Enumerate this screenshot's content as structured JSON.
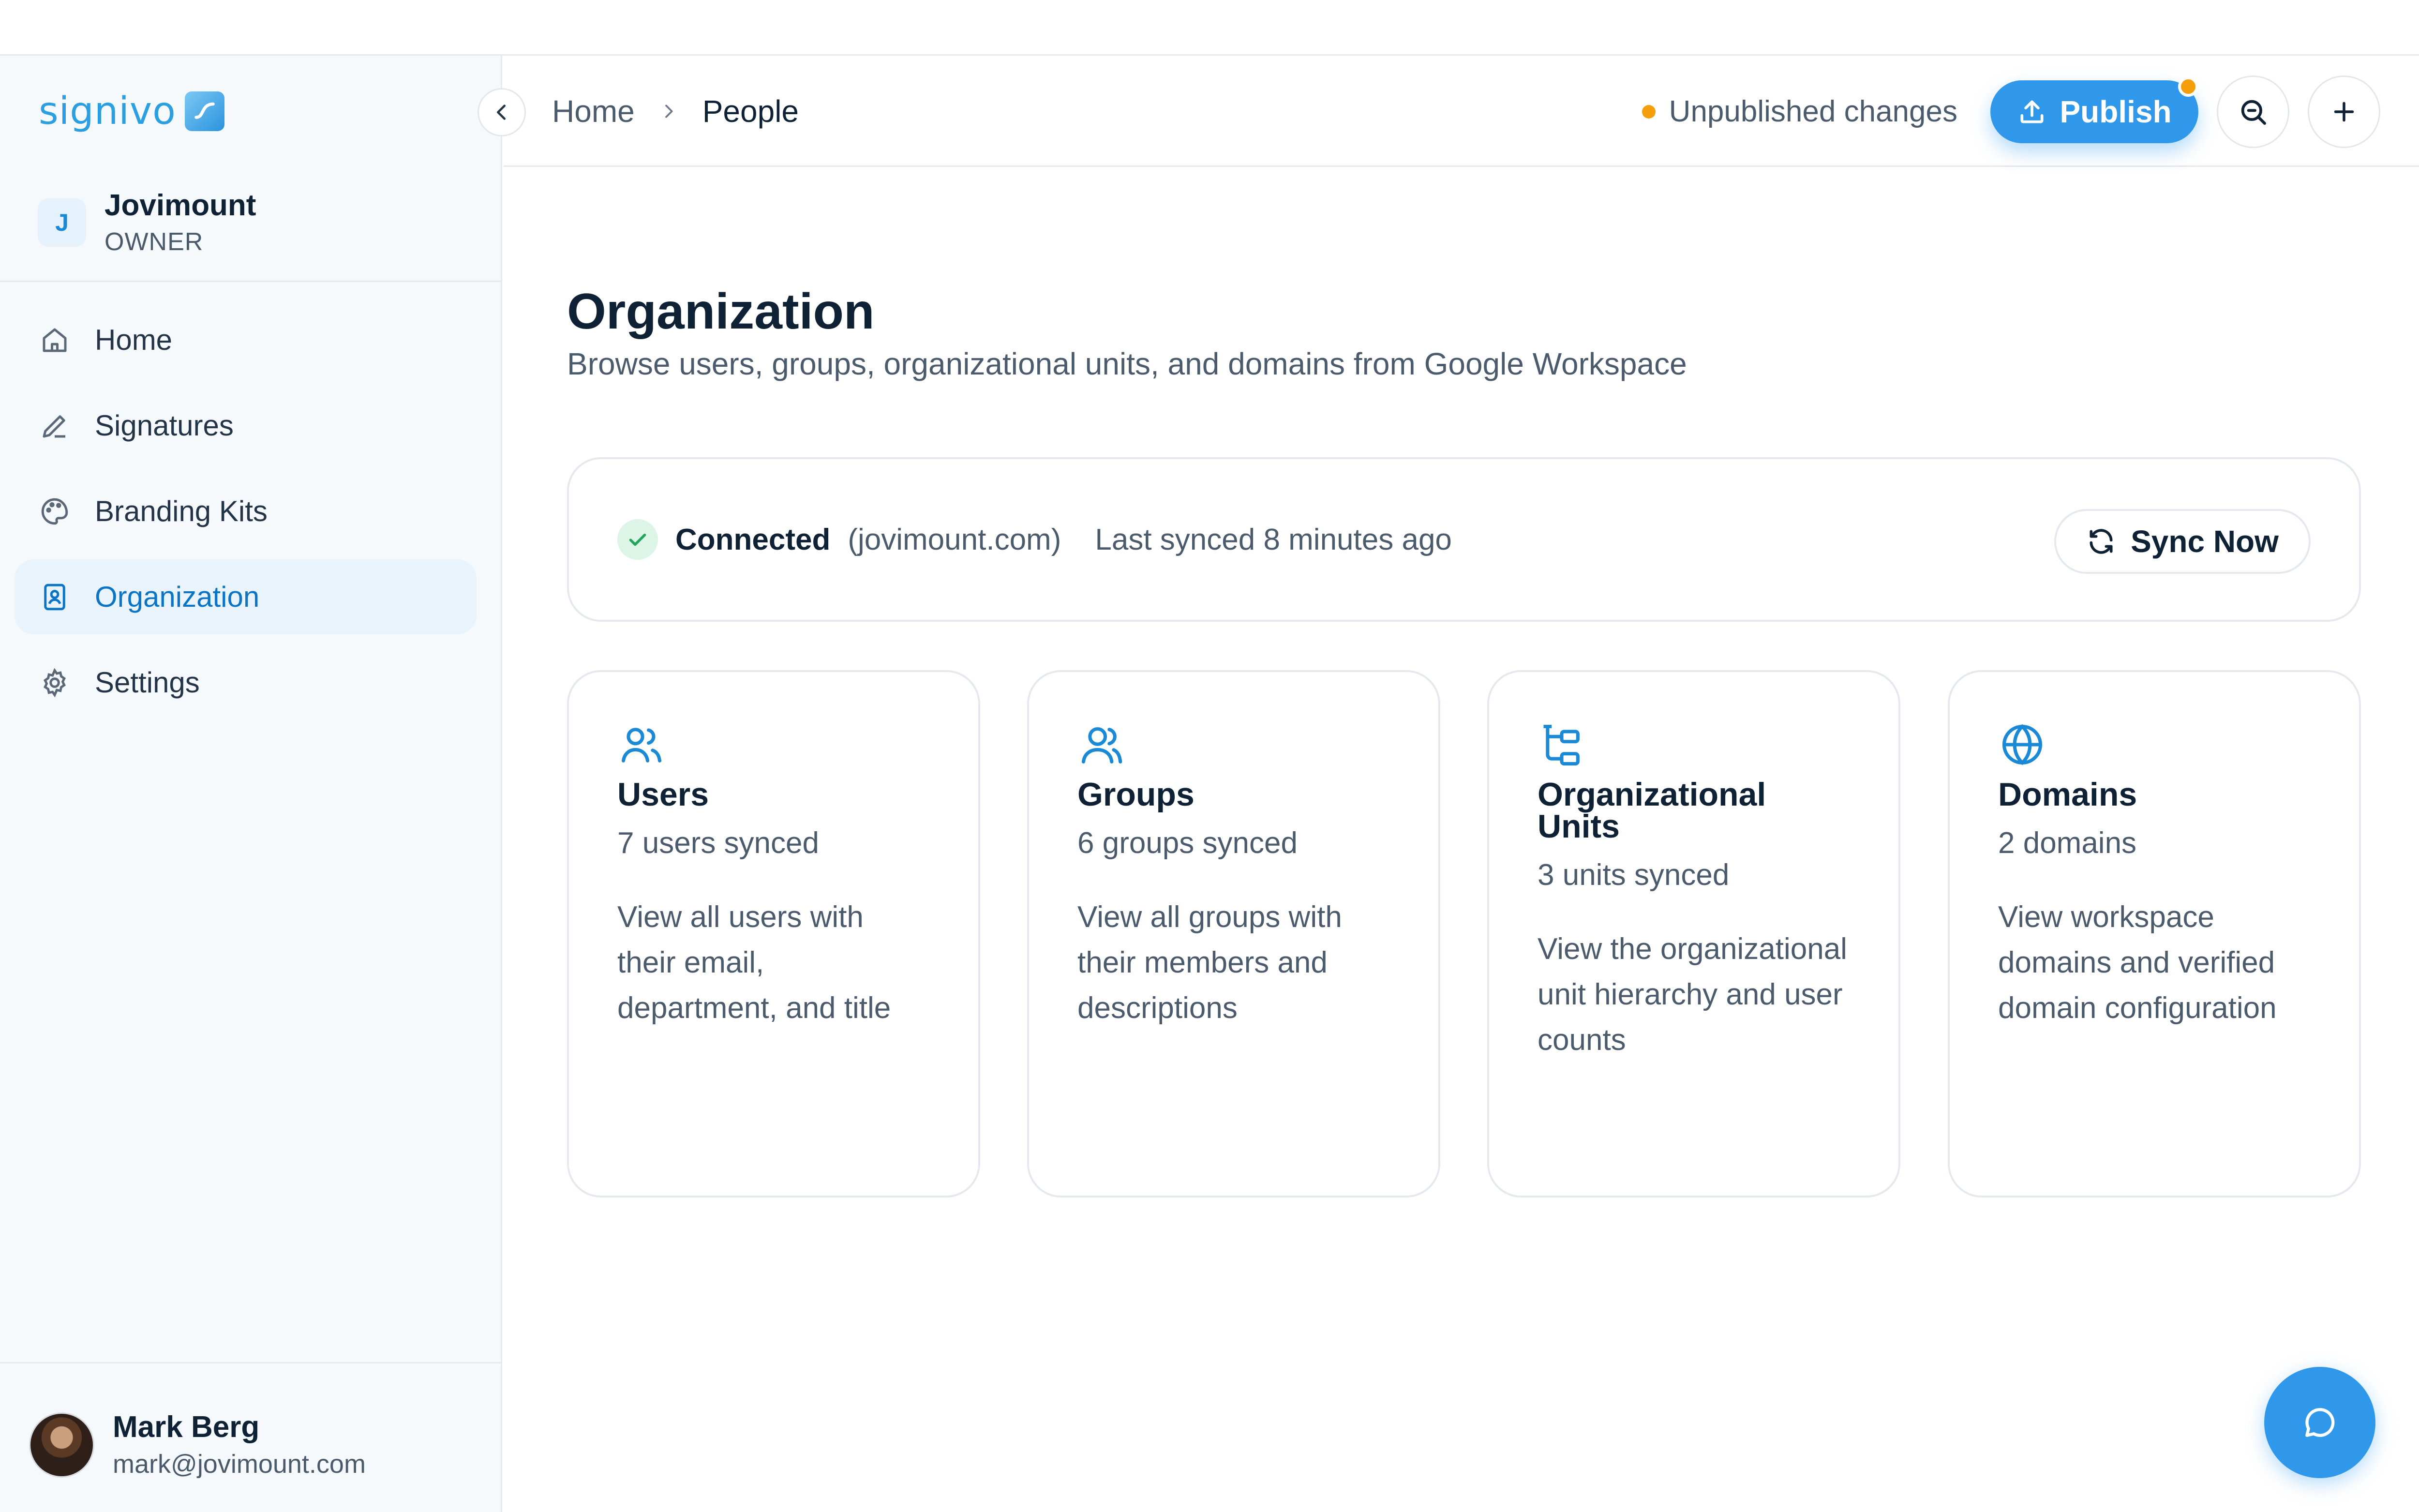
{
  "brand": {
    "name": "signivo",
    "color": "#2b9fe0"
  },
  "workspace": {
    "initial": "J",
    "name": "Jovimount",
    "role": "OWNER"
  },
  "sidebar": {
    "items": [
      {
        "label": "Home",
        "icon": "home-icon",
        "active": false
      },
      {
        "label": "Signatures",
        "icon": "pen-icon",
        "active": false
      },
      {
        "label": "Branding Kits",
        "icon": "palette-icon",
        "active": false
      },
      {
        "label": "Organization",
        "icon": "contact-book-icon",
        "active": true
      },
      {
        "label": "Settings",
        "icon": "gear-icon",
        "active": false
      }
    ]
  },
  "user": {
    "name": "Mark Berg",
    "email": "mark@jovimount.com"
  },
  "breadcrumb": {
    "home": "Home",
    "current": "People"
  },
  "header": {
    "unpublished_label": "Unpublished changes",
    "publish_label": "Publish"
  },
  "page": {
    "title": "Organization",
    "subtitle": "Browse users, groups, organizational units, and domains from Google Workspace"
  },
  "status": {
    "connected_label": "Connected",
    "domain": "(jovimount.com)",
    "last_synced": "Last synced 8 minutes ago",
    "sync_button": "Sync Now"
  },
  "cards": [
    {
      "title": "Users",
      "count": "7 users synced",
      "description": "View all users with their email, department, and title",
      "icon": "users-icon"
    },
    {
      "title": "Groups",
      "count": "6 groups synced",
      "description": "View all groups with their members and descriptions",
      "icon": "group-icon"
    },
    {
      "title": "Organizational Units",
      "count": "3 units synced",
      "description": "View the organizational unit hierarchy and user counts",
      "icon": "org-tree-icon"
    },
    {
      "title": "Domains",
      "count": "2 domains",
      "description": "View workspace domains and verified domain configuration",
      "icon": "globe-icon"
    }
  ],
  "colors": {
    "accent": "#2f98ea",
    "warning": "#f59e0b",
    "success": "#22a55a",
    "active_nav_bg": "#e8f3fc"
  }
}
